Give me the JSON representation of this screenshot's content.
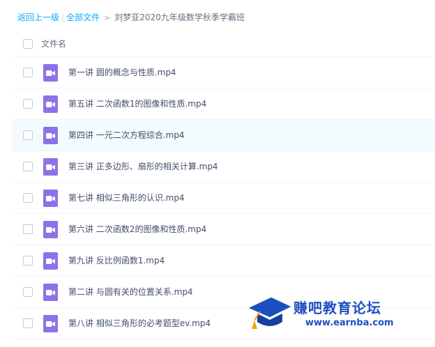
{
  "breadcrumb": {
    "back_label": "返回上一级",
    "separator": "|",
    "all_files_label": "全部文件",
    "arrow": ">",
    "current_folder": "刘梦亚2020九年级数学秋季学霸班"
  },
  "table": {
    "column_header": "文件名",
    "rows": [
      {
        "name": "第一讲 圆的概念与性质.mp4"
      },
      {
        "name": "第五讲 二次函数1的图像和性质.mp4"
      },
      {
        "name": "第四讲 一元二次方程综合.mp4"
      },
      {
        "name": "第三讲 正多边形、扇形的相关计算.mp4"
      },
      {
        "name": "第七讲 相似三角形的认识.mp4"
      },
      {
        "name": "第六讲 二次函数2的图像和性质.mp4"
      },
      {
        "name": "第九讲 反比例函数1.mp4"
      },
      {
        "name": "第二讲 与圆有关的位置关系.mp4"
      },
      {
        "name": "第八讲 相似三角形的必考题型ev.mp4"
      }
    ],
    "hovered_row": 2
  },
  "watermark": {
    "title": "赚吧教育论坛",
    "url": "www.earnba.com"
  },
  "colors": {
    "link": "#09aaff",
    "video_icon": "#8c72e6",
    "row_hover": "#f4fbff",
    "watermark_text": "#1e4fc0"
  },
  "icons": {
    "file_type": "video-file-icon",
    "breadcrumb_arrow": "chevron-right-icon",
    "watermark_logo": "graduation-cap-icon"
  }
}
